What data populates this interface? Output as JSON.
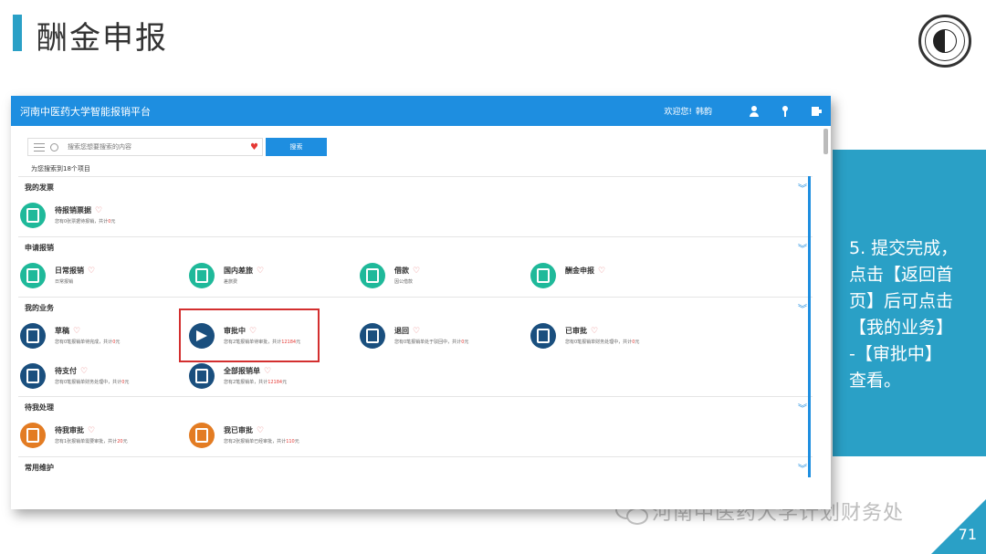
{
  "slide": {
    "title": "酬金申报",
    "seal_text": "河南中医药大学",
    "instruction": "5. 提交完成，\n点击【返回首\n页】后可点击\n【我的业务】\n-【审批中】\n查看。",
    "footer": "河南中医药大学计划财务处",
    "page_number": "71"
  },
  "app": {
    "title": "河南中医药大学智能报销平台",
    "welcome": "欢迎您!",
    "user": "韩韵",
    "search": {
      "placeholder": "搜索您想要搜索的内容",
      "button": "搜索"
    },
    "result_count": "为您搜索到18个项目",
    "sections": [
      {
        "title": "我的发票",
        "items": [
          {
            "title": "待报销票据",
            "desc_pre": "您有0张票据待报销，共计",
            "desc_hl": "0",
            "desc_post": "元"
          }
        ]
      },
      {
        "title": "申请报销",
        "items": [
          {
            "title": "日常报销",
            "desc": "日常报销"
          },
          {
            "title": "国内差旅",
            "desc": "差旅费"
          },
          {
            "title": "借款",
            "desc": "因公借款"
          },
          {
            "title": "酬金申报",
            "desc": ""
          }
        ]
      },
      {
        "title": "我的业务",
        "items": [
          {
            "title": "草稿",
            "desc_pre": "您有0笔报销单待完成，共计",
            "desc_hl": "0",
            "desc_post": "元"
          },
          {
            "title": "审批中",
            "desc_pre": "您有2笔报销单待审批，共计",
            "desc_hl": "12184",
            "desc_post": "元"
          },
          {
            "title": "退回",
            "desc_pre": "您有0笔报销单处于驳回中，共计",
            "desc_hl": "0",
            "desc_post": "元"
          },
          {
            "title": "已审批",
            "desc_pre": "您有0笔报销单财务处理中，共计",
            "desc_hl": "0",
            "desc_post": "元"
          },
          {
            "title": "待支付",
            "desc_pre": "您有0笔报销单财务处理中，共计",
            "desc_hl": "0",
            "desc_post": "元"
          },
          {
            "title": "全部报销单",
            "desc_pre": "您有2笔报销单，共计",
            "desc_hl": "12184",
            "desc_post": "元"
          }
        ]
      },
      {
        "title": "待我处理",
        "items": [
          {
            "title": "待我审批",
            "desc_pre": "您有1张报销单需要审批，共计",
            "desc_hl": "20",
            "desc_post": "元"
          },
          {
            "title": "我已审批",
            "desc_pre": "您有2张报销单已经审批，共计",
            "desc_hl": "110",
            "desc_post": "元"
          }
        ]
      },
      {
        "title": "常用维护",
        "items": []
      }
    ]
  },
  "colors": {
    "accent": "#2aa0c6",
    "topbar": "#1e8ee0",
    "highlight": "#d32f2f",
    "green": "#1fb99a",
    "navy": "#1a4f7e",
    "orange": "#e37c23"
  }
}
